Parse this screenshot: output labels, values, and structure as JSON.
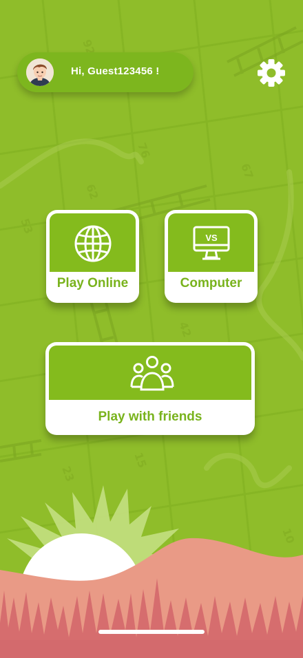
{
  "header": {
    "greeting": "Hi, Guest123456 !"
  },
  "modes": {
    "online_label": "Play Online",
    "computer_label": "Computer",
    "computer_icon_text": "VS",
    "friends_label": "Play with friends"
  },
  "colors": {
    "background": "#8fbd2a",
    "accent": "#84bb1d",
    "card": "#ffffff",
    "hill": "#e78f80"
  },
  "icons": [
    "avatar",
    "gear-icon",
    "globe-icon",
    "monitor-vs-icon",
    "group-icon"
  ]
}
